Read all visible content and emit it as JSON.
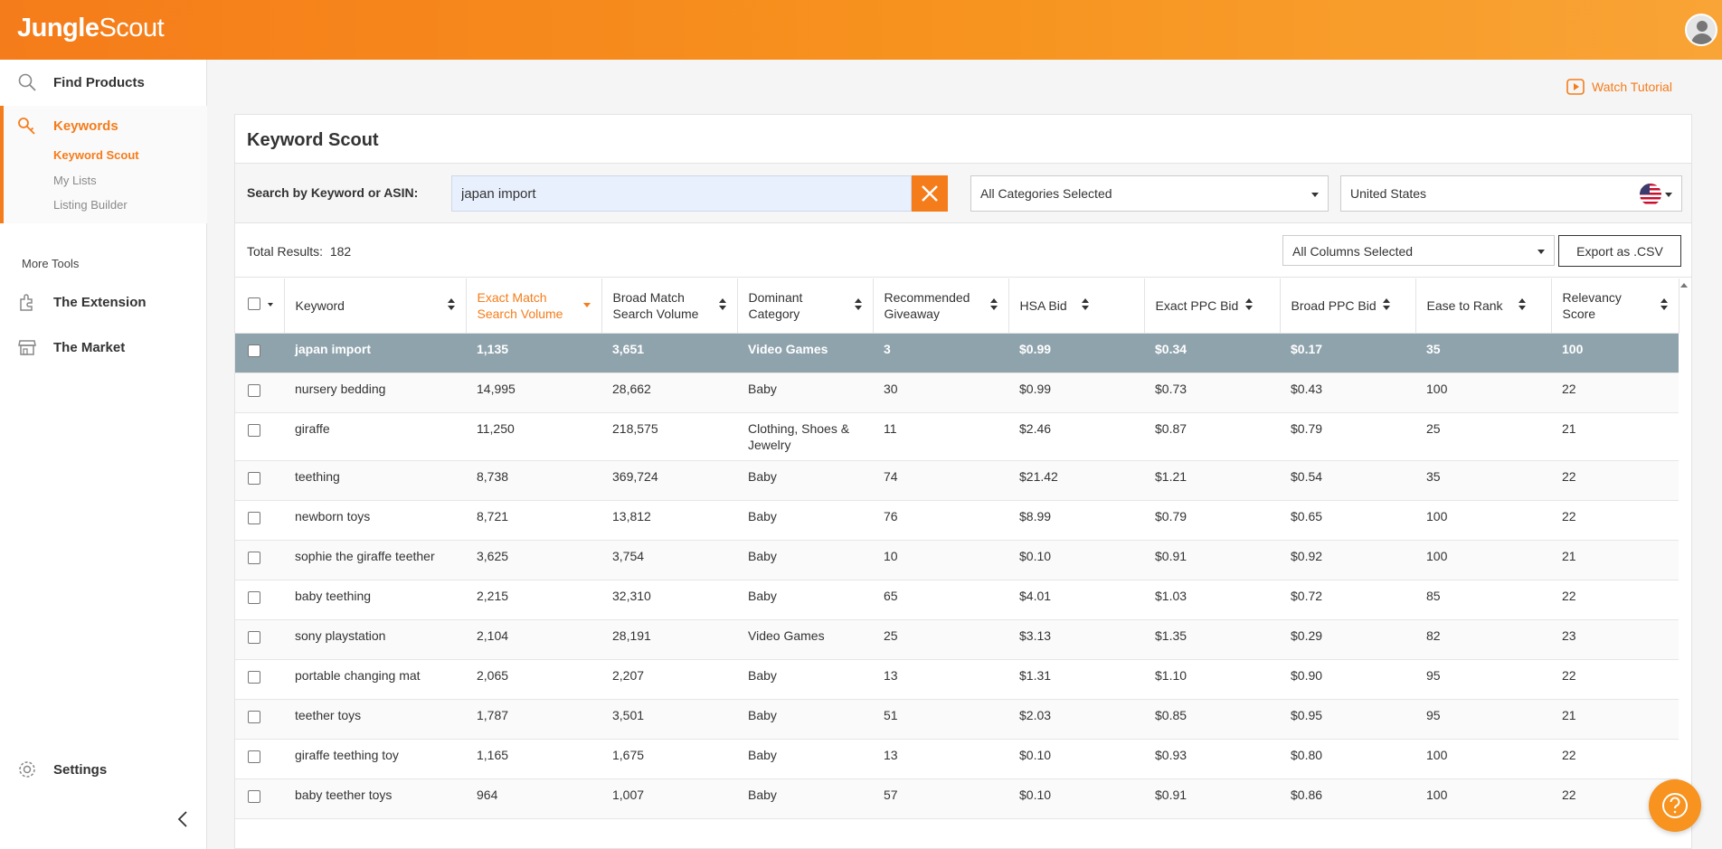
{
  "app": {
    "logo_bold": "Jungle",
    "logo_light": "Scout"
  },
  "sidebar": {
    "find_products": "Find Products",
    "keywords": "Keywords",
    "keyword_scout": "Keyword Scout",
    "my_lists": "My Lists",
    "listing_builder": "Listing Builder",
    "more_tools": "More Tools",
    "extension": "The Extension",
    "market": "The Market",
    "settings": "Settings"
  },
  "main": {
    "watch_tutorial": "Watch Tutorial",
    "title": "Keyword Scout",
    "search_label": "Search by Keyword or ASIN:",
    "search_value": "japan import",
    "categories": "All Categories Selected",
    "country": "United States",
    "total_label": "Total Results:",
    "total_value": "182",
    "columns": "All Columns Selected",
    "export": "Export as .CSV"
  },
  "table": {
    "headers": {
      "keyword": "Keyword",
      "exact_a": "Exact Match",
      "exact_b": "Search Volume",
      "broad_a": "Broad Match",
      "broad_b": "Search Volume",
      "cat_a": "Dominant",
      "cat_b": "Category",
      "give_a": "Recommended",
      "give_b": "Giveaway",
      "hsa": "HSA Bid",
      "exact_ppc": "Exact PPC Bid",
      "broad_ppc": "Broad PPC Bid",
      "ease": "Ease to Rank",
      "rel_a": "Relevancy",
      "rel_b": "Score"
    },
    "rows": [
      [
        "japan import",
        "1,135",
        "3,651",
        "Video Games",
        "3",
        "$0.99",
        "$0.34",
        "$0.17",
        "35",
        "100"
      ],
      [
        "nursery bedding",
        "14,995",
        "28,662",
        "Baby",
        "30",
        "$0.99",
        "$0.73",
        "$0.43",
        "100",
        "22"
      ],
      [
        "giraffe",
        "11,250",
        "218,575",
        "Clothing, Shoes & Jewelry",
        "11",
        "$2.46",
        "$0.87",
        "$0.79",
        "25",
        "21"
      ],
      [
        "teething",
        "8,738",
        "369,724",
        "Baby",
        "74",
        "$21.42",
        "$1.21",
        "$0.54",
        "35",
        "22"
      ],
      [
        "newborn toys",
        "8,721",
        "13,812",
        "Baby",
        "76",
        "$8.99",
        "$0.79",
        "$0.65",
        "100",
        "22"
      ],
      [
        "sophie the giraffe teether",
        "3,625",
        "3,754",
        "Baby",
        "10",
        "$0.10",
        "$0.91",
        "$0.92",
        "100",
        "21"
      ],
      [
        "baby teething",
        "2,215",
        "32,310",
        "Baby",
        "65",
        "$4.01",
        "$1.03",
        "$0.72",
        "85",
        "22"
      ],
      [
        "sony playstation",
        "2,104",
        "28,191",
        "Video Games",
        "25",
        "$3.13",
        "$1.35",
        "$0.29",
        "82",
        "23"
      ],
      [
        "portable changing mat",
        "2,065",
        "2,207",
        "Baby",
        "13",
        "$1.31",
        "$1.10",
        "$0.90",
        "95",
        "22"
      ],
      [
        "teether toys",
        "1,787",
        "3,501",
        "Baby",
        "51",
        "$2.03",
        "$0.85",
        "$0.95",
        "95",
        "21"
      ],
      [
        "giraffe teething toy",
        "1,165",
        "1,675",
        "Baby",
        "13",
        "$0.10",
        "$0.93",
        "$0.80",
        "100",
        "22"
      ],
      [
        "baby teether toys",
        "964",
        "1,007",
        "Baby",
        "57",
        "$0.10",
        "$0.91",
        "$0.86",
        "100",
        "22"
      ]
    ]
  },
  "colors": {
    "accent": "#f57c1a",
    "selected_row": "#8fa3ad"
  }
}
